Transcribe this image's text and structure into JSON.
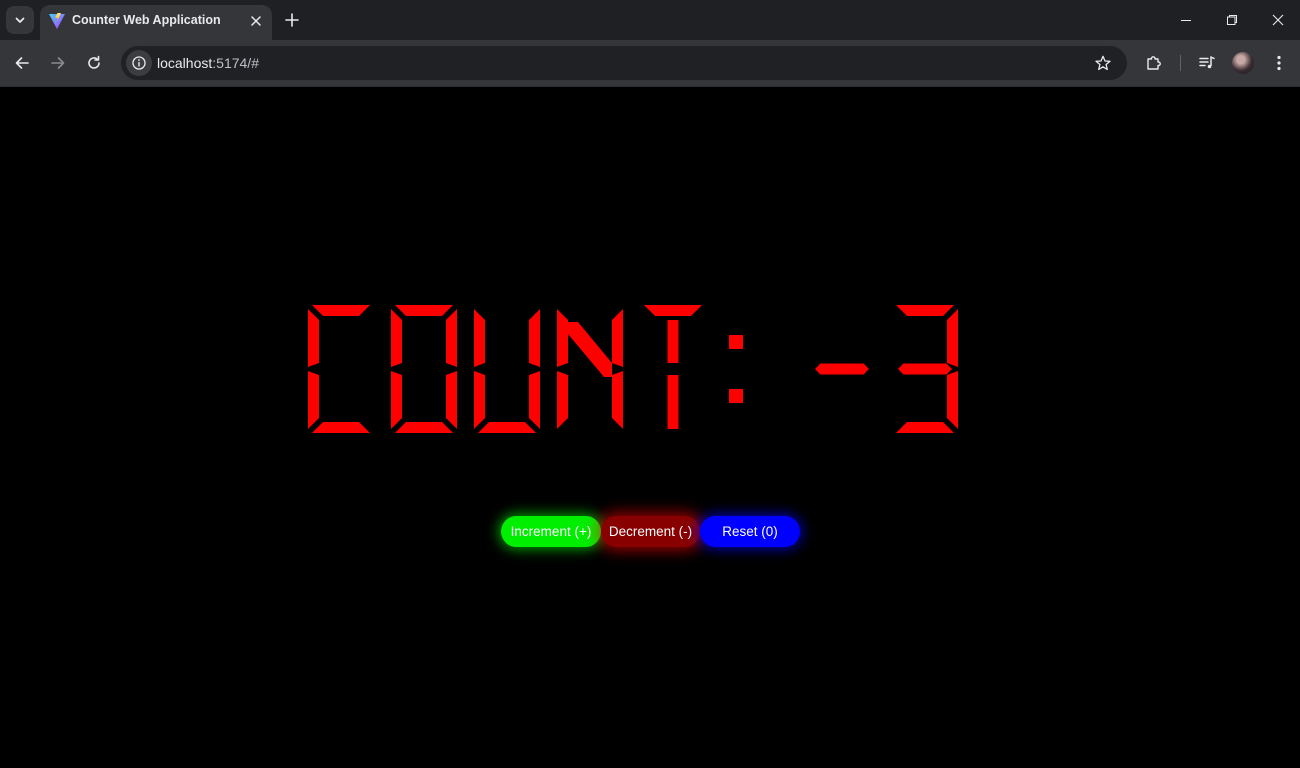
{
  "browser": {
    "tab_title": "Counter Web Application",
    "url_host": "localhost",
    "url_rest": ":5174/#"
  },
  "icons": {
    "tab_list": "chevron-down-icon",
    "favicon": "vite-logo-icon",
    "tab_close": "close-icon",
    "new_tab": "plus-icon",
    "back": "arrow-left-icon",
    "forward": "arrow-right-icon",
    "reload": "reload-icon",
    "site_info": "info-icon",
    "bookmark": "star-icon",
    "extensions": "puzzle-icon",
    "media": "media-controls-icon",
    "menu": "more-vertical-icon"
  },
  "counter": {
    "text": "COUNT: -3",
    "label": "COUNT:",
    "value": -3,
    "color": "#ff0000"
  },
  "controls": {
    "increment_label": "Increment (+)",
    "decrement_label": "Decrement (-)",
    "reset_label": "Reset (0)",
    "increment_color": "#00ee00",
    "decrement_color": "#880000",
    "reset_color": "#0000ff"
  }
}
